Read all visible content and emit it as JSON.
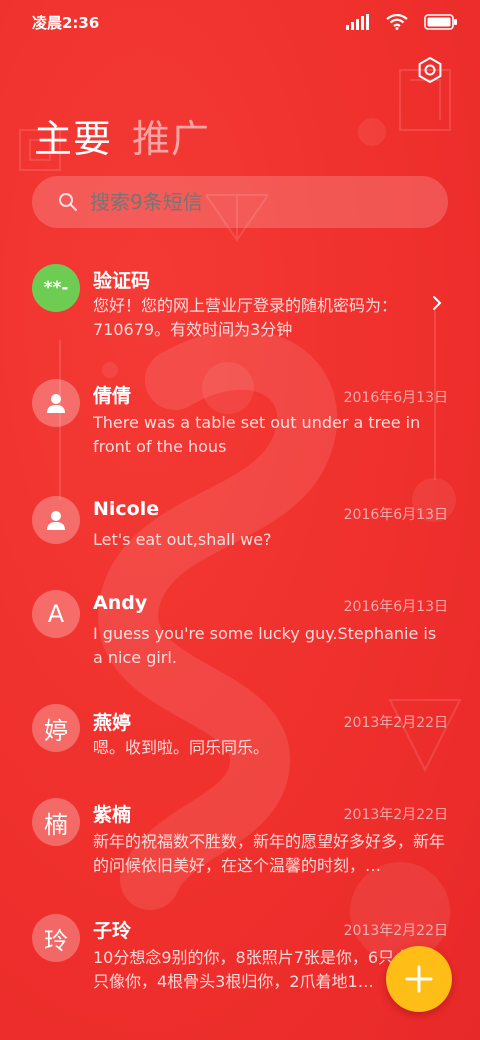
{
  "status": {
    "time": "凌晨2:36"
  },
  "icons": {
    "settings": "gear-icon",
    "search": "search-icon",
    "contact": "person-icon",
    "compose": "plus-icon"
  },
  "tabs": [
    {
      "label": "主要",
      "active": true
    },
    {
      "label": "推广",
      "active": false
    }
  ],
  "search": {
    "placeholder": "搜索9条短信"
  },
  "messages": [
    {
      "avatar": "**-",
      "name": "验证码",
      "date": "",
      "preview": "您好！您的网上营业厅登录的随机密码为：\n710679。有效时间为3分钟"
    },
    {
      "avatar": "",
      "name": "倩倩",
      "date": "2016年6月13日",
      "preview": "There was a table set out under a tree in front of the hous"
    },
    {
      "avatar": "",
      "name": "Nicole",
      "date": "2016年6月13日",
      "preview": "Let's eat out,shall we?"
    },
    {
      "avatar": "A",
      "name": "Andy",
      "date": "2016年6月13日",
      "preview": "I guess you're some lucky guy.Stephanie is a nice girl."
    },
    {
      "avatar": "婷",
      "name": "燕婷",
      "date": "2013年2月22日",
      "preview": "嗯。收到啦。同乐同乐。"
    },
    {
      "avatar": "楠",
      "name": "紫楠",
      "date": "2013年2月22日",
      "preview": "新年的祝福数不胜数，新年的愿望好多好多，新年的问候依旧美好，在这个温馨的时刻，…"
    },
    {
      "avatar": "玲",
      "name": "子玲",
      "date": "2013年2月22日",
      "preview": "10分想念9别的你，8张照片7张是你，6只小狗5只像你，4根骨头3根归你，2爪着地1…"
    }
  ],
  "colors": {
    "background": "#ef302c",
    "avatar_green": "#6fcc52",
    "fab": "#ffbd18"
  }
}
